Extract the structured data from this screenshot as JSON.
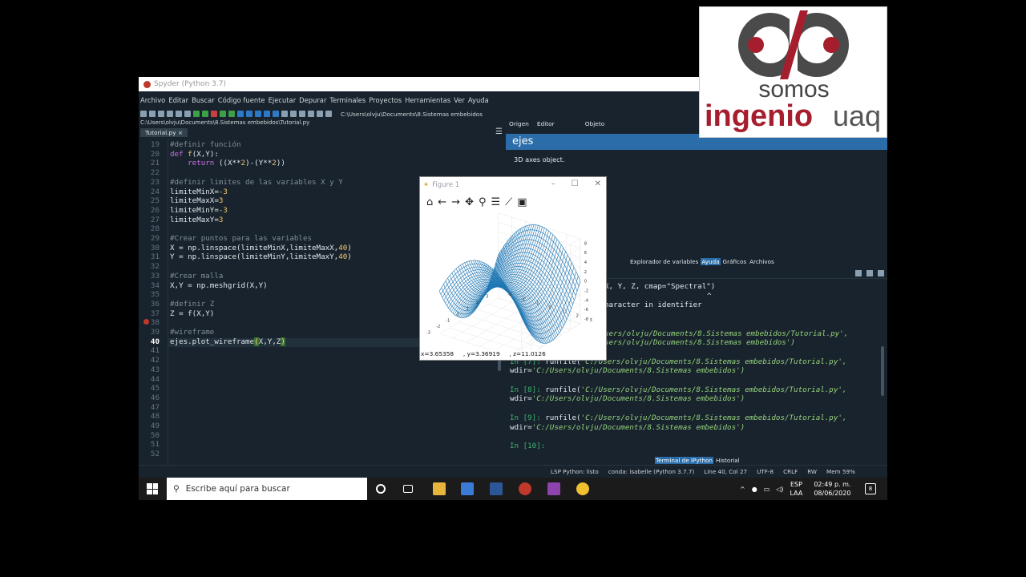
{
  "spyder": {
    "title": "Spyder (Python 3.7)",
    "menu": [
      "Archivo",
      "Editar",
      "Buscar",
      "Código fuente",
      "Ejecutar",
      "Depurar",
      "Terminales",
      "Proyectos",
      "Herramientas",
      "Ver",
      "Ayuda"
    ],
    "toolbar_path": "C:\\Users\\olvju\\Documents\\8.Sistemas embebidos"
  },
  "editor": {
    "file_path": "C:\\Users\\olvju\\Documents\\8.Sistemas embebidos\\Tutorial.py",
    "tab": "Tutorial.py",
    "menu_glyph": "☰",
    "current_line": 40,
    "breakpoint_line": 38
  },
  "help": {
    "tabs": [
      "Origen",
      "Editor",
      "Objeto"
    ],
    "title": "ejes",
    "body": "3D axes object.",
    "bottom_tabs": [
      "Explorador de variables",
      "Ayuda",
      "Gráficos",
      "Archivos"
    ],
    "active_bottom_tab": "Ayuda"
  },
  "console": {
    "lines": [
      {
        "t": "X, Y, Z, cmap=\"Spectral\")",
        "indent": 118
      },
      {
        "t": "^",
        "indent": 246
      },
      {
        "t": "haracter in identifier",
        "indent": 118
      },
      {
        "t": "",
        "indent": 0
      },
      {
        "t": "",
        "indent": 0
      },
      {
        "t": "sers/olvju/Documents/8.Sistemas embebidos/Tutorial.py',",
        "indent": 118,
        "italic": true
      },
      {
        "t": "sers/olvju/Documents/8.Sistemas embebidos')",
        "indent": 118,
        "italic": true
      },
      {
        "t": "",
        "indent": 0
      },
      {
        "t": "In [7]: runfile('C:/Users/olvju/Documents/8.Sistemas embebidos/Tutorial.py',",
        "indent": 0
      },
      {
        "t": "wdir='C:/Users/olvju/Documents/8.Sistemas embebidos')",
        "indent": 0
      },
      {
        "t": "",
        "indent": 0
      },
      {
        "t": "In [8]: runfile('C:/Users/olvju/Documents/8.Sistemas embebidos/Tutorial.py',",
        "indent": 0
      },
      {
        "t": "wdir='C:/Users/olvju/Documents/8.Sistemas embebidos')",
        "indent": 0
      },
      {
        "t": "",
        "indent": 0
      },
      {
        "t": "In [9]: runfile('C:/Users/olvju/Documents/8.Sistemas embebidos/Tutorial.py',",
        "indent": 0
      },
      {
        "t": "wdir='C:/Users/olvju/Documents/8.Sistemas embebidos')",
        "indent": 0
      },
      {
        "t": "",
        "indent": 0
      },
      {
        "t": "In [10]:",
        "indent": 0
      }
    ],
    "tabs": [
      "Terminal de IPython",
      "Historial"
    ],
    "active_tab": "Terminal de IPython"
  },
  "statusbar": {
    "lsp": "LSP Python: listo",
    "conda": "conda: isabelle (Python 3.7.7)",
    "position": "Line 40, Col 27",
    "encoding": "UTF-8",
    "eol": "CRLF",
    "rw": "RW",
    "mem": "Mem 59%"
  },
  "figure": {
    "title": "Figure 1",
    "status": "x=3.65358     , y=3.36919     , z=11.0126",
    "x_ticks": [
      "-3",
      "-2",
      "-1",
      "0",
      "1",
      "2",
      "3"
    ],
    "y_ticks": [
      "-3",
      "-2",
      "-1",
      "0",
      "1",
      "2",
      "3"
    ],
    "z_ticks": [
      "-8",
      "-6",
      "-4",
      "-2",
      "0",
      "2",
      "4",
      "6",
      "8"
    ],
    "wire_color": "#1f77b4"
  },
  "logo": {
    "somos": "somos",
    "ingenio": "ingenio",
    "uaq": "uaq",
    "brand_red": "#a61e2e"
  },
  "taskbar": {
    "search_placeholder": "Escribe aquí para buscar",
    "lang1": "ESP",
    "lang2": "LAA",
    "time": "02:49 p. m.",
    "date": "08/06/2020",
    "notif_count": "8"
  }
}
